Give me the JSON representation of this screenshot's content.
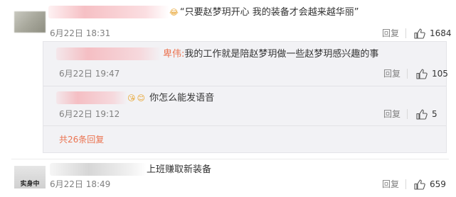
{
  "comments": [
    {
      "text": "“只要赵梦玥开心 我的装备才会越来越华丽”",
      "time": "6月22日 18:31",
      "reply_label": "回复",
      "likes": "1684",
      "sub_replies": [
        {
          "author": "卑伟:",
          "text": "我的工作就是陪赵梦玥做一些赵梦玥感兴趣的事",
          "time": "6月22日 19:47",
          "reply_label": "回复",
          "likes": "105"
        },
        {
          "text": "你怎么能发语音",
          "time": "6月22日 19:12",
          "reply_label": "回复",
          "likes": "5"
        }
      ],
      "more_replies": "共26条回复"
    },
    {
      "avatar_text": "实身中",
      "text": "上班赚取新装备",
      "time": "6月22日 18:49",
      "reply_label": "回复",
      "likes": "659"
    }
  ],
  "icons": [
    "thumbs-up-icon",
    "emoji-icon"
  ]
}
